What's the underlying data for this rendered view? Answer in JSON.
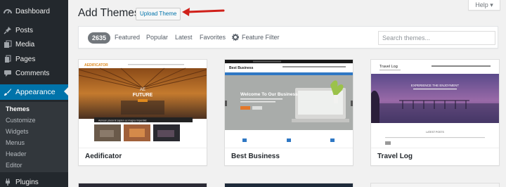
{
  "sidebar": {
    "items": [
      {
        "label": "Dashboard",
        "icon": "dashboard-icon"
      },
      {
        "label": "Posts",
        "icon": "pin-icon"
      },
      {
        "label": "Media",
        "icon": "media-icon"
      },
      {
        "label": "Pages",
        "icon": "pages-icon"
      },
      {
        "label": "Comments",
        "icon": "comments-icon"
      },
      {
        "label": "Appearance",
        "icon": "brush-icon"
      },
      {
        "label": "Plugins",
        "icon": "plug-icon"
      }
    ],
    "submenu": [
      "Themes",
      "Customize",
      "Widgets",
      "Menus",
      "Header",
      "Editor"
    ]
  },
  "header": {
    "title": "Add Themes",
    "upload_label": "Upload Theme",
    "help_label": "Help ▾"
  },
  "filters": {
    "count": "2635",
    "links": [
      "Featured",
      "Popular",
      "Latest",
      "Favorites"
    ],
    "feature_filter": "Feature Filter",
    "search_placeholder": "Search themes..."
  },
  "themes": [
    {
      "name": "Aedificator",
      "logo": "AEDIFICATOR",
      "hero_lines": [
        "AE",
        "FUTURE"
      ],
      "banner": "Aenean placerat sapien ac magna imperdiet"
    },
    {
      "name": "Best Business",
      "logo": "Best Business",
      "hero": "Welcome To Our Business"
    },
    {
      "name": "Travel Log",
      "logo": "Travel Log",
      "hero": "EXPERIENCE THE ENJOYMENT",
      "sub_heading": "LATEST POSTS"
    }
  ],
  "colors": {
    "sidebar_bg": "#23282d",
    "active_blue": "#0073aa",
    "arrow_red": "#d0201a"
  }
}
